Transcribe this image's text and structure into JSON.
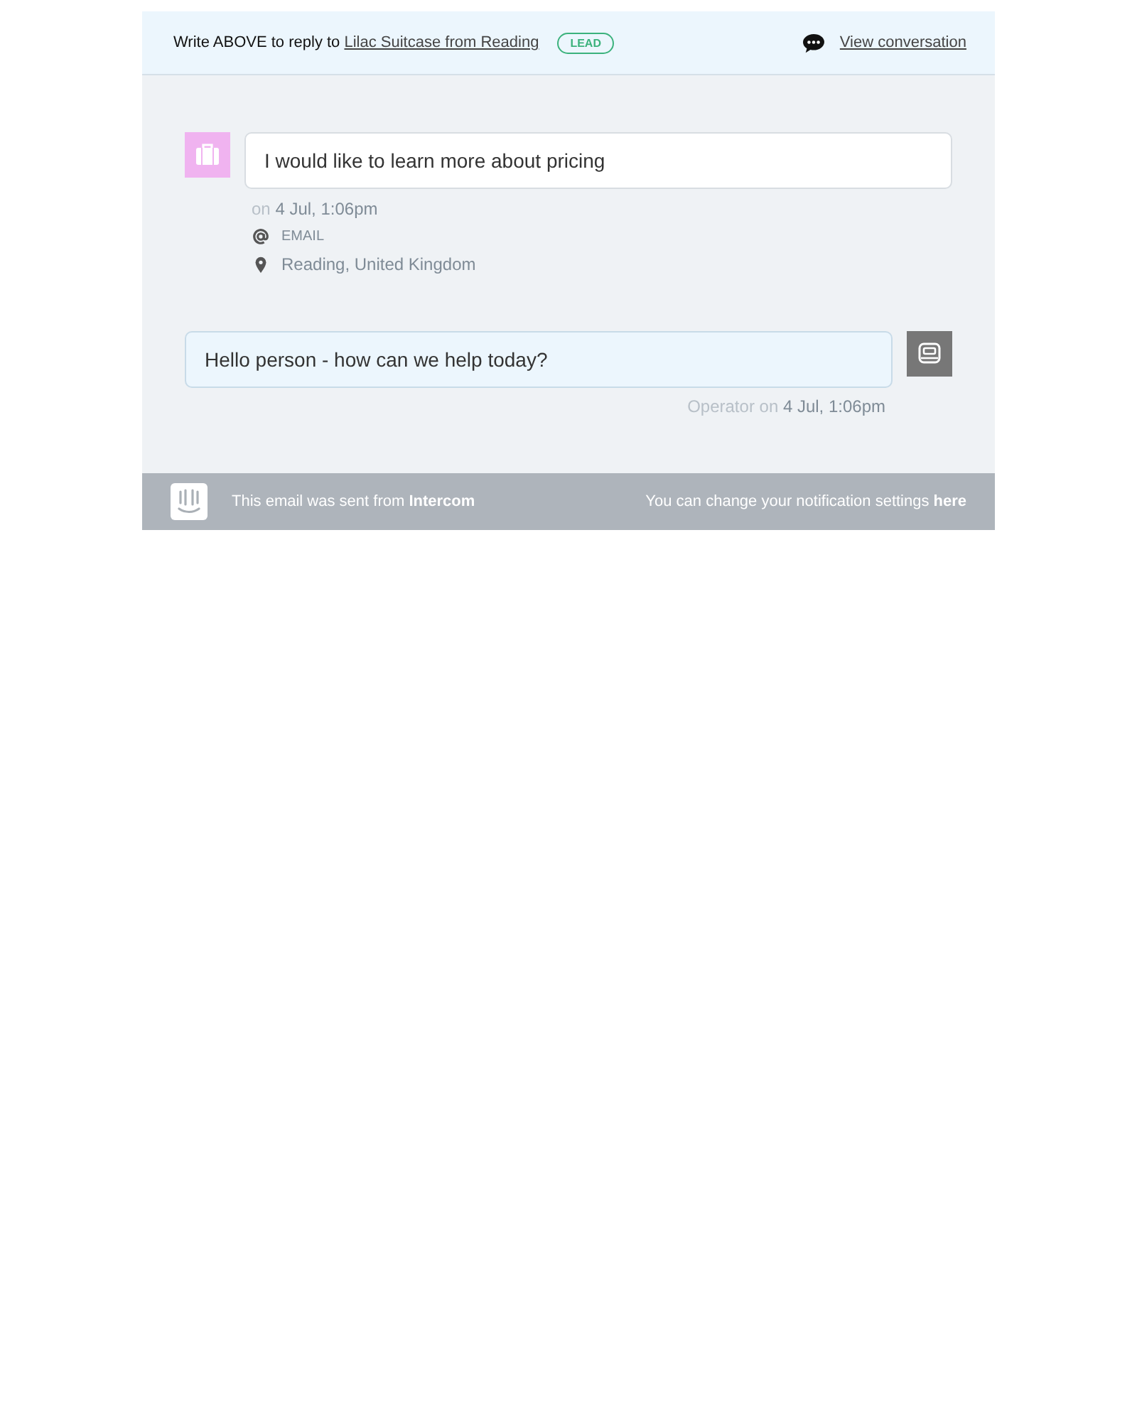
{
  "header": {
    "prompt": "Write ABOVE to reply to",
    "contact_link": "Lilac Suitcase from Reading",
    "badge": "LEAD",
    "view_link": "View conversation"
  },
  "messages": [
    {
      "kind": "user",
      "text": "I would like to learn more about pricing",
      "meta_prefix": "on",
      "time": "4 Jul, 1:06pm",
      "details": [
        {
          "kind": "email",
          "text": "EMAIL"
        },
        {
          "kind": "location",
          "text": "Reading, United Kingdom"
        }
      ]
    },
    {
      "kind": "operator",
      "text": "Hello person - how can we help today?",
      "meta_prefix": "Operator on",
      "time": "4 Jul, 1:06pm"
    }
  ],
  "footer": {
    "sent_from": "This email was sent from **Intercom**",
    "settings_text": "You can change your notification settings",
    "settings_link": "here"
  }
}
